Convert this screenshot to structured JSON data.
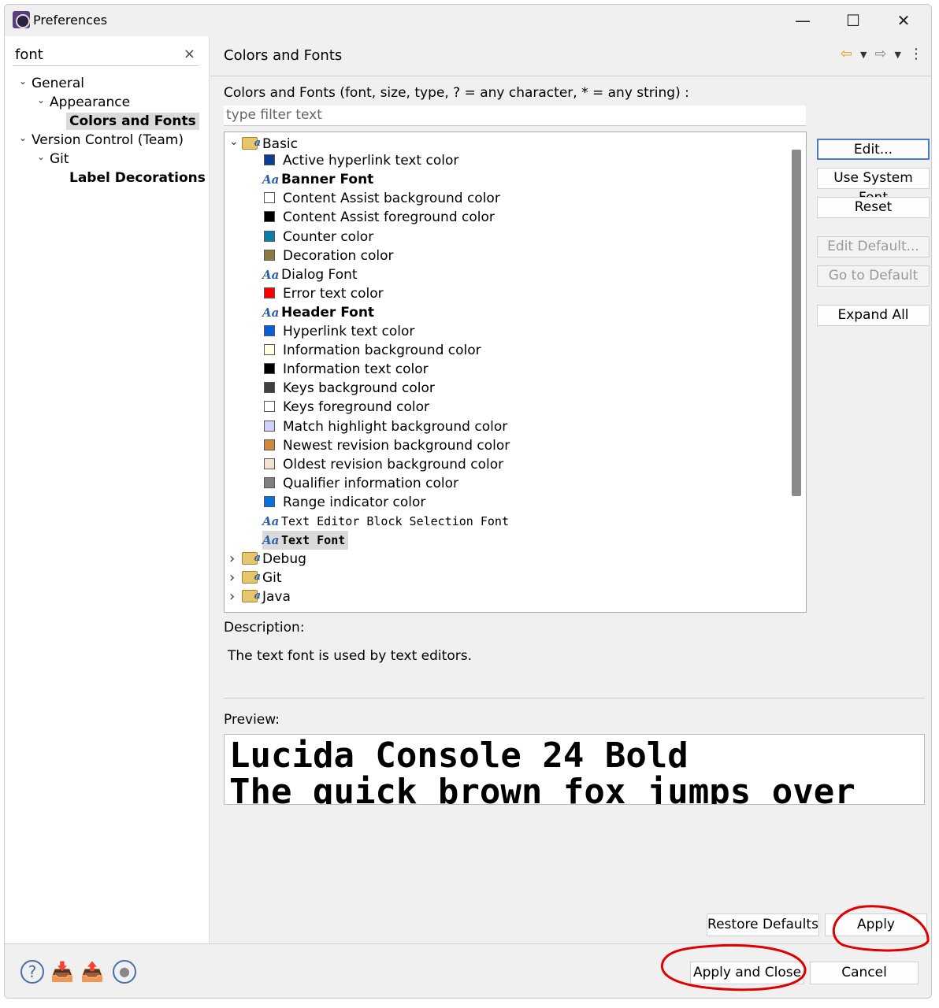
{
  "window": {
    "title": "Preferences",
    "minimize": "—",
    "maximize": "☐",
    "close": "✕"
  },
  "sidebar": {
    "search_value": "font",
    "clear": "×",
    "items": [
      {
        "label": "General",
        "level": 0,
        "expanded": true
      },
      {
        "label": "Appearance",
        "level": 1,
        "expanded": true
      },
      {
        "label": "Colors and Fonts",
        "level": 2,
        "selected": true,
        "bold": true
      },
      {
        "label": "Version Control (Team)",
        "level": 0,
        "expanded": true
      },
      {
        "label": "Git",
        "level": 1,
        "expanded": true
      },
      {
        "label": "Label Decorations",
        "level": 2,
        "bold": true
      }
    ]
  },
  "page": {
    "title": "Colors and Fonts",
    "filter_label": "Colors and Fonts (font, size, type, ? = any character, * = any string) :",
    "filter_placeholder": "type filter text",
    "tree": [
      {
        "type": "category",
        "label": "Basic",
        "expanded": true
      },
      {
        "type": "color",
        "label": "Active hyperlink text color",
        "color": "#0b3d91"
      },
      {
        "type": "font",
        "label": "Banner Font",
        "style": "bold"
      },
      {
        "type": "color",
        "label": "Content Assist background color",
        "color": "#ffffff"
      },
      {
        "type": "color",
        "label": "Content Assist foreground color",
        "color": "#000000"
      },
      {
        "type": "color",
        "label": "Counter color",
        "color": "#0a7fa8"
      },
      {
        "type": "color",
        "label": "Decoration color",
        "color": "#8c7a45"
      },
      {
        "type": "font",
        "label": "Dialog Font",
        "style": "normal"
      },
      {
        "type": "color",
        "label": "Error text color",
        "color": "#ff0000"
      },
      {
        "type": "font",
        "label": "Header Font",
        "style": "bold"
      },
      {
        "type": "color",
        "label": "Hyperlink text color",
        "color": "#0a5fd4"
      },
      {
        "type": "color",
        "label": "Information background color",
        "color": "#ffffe1"
      },
      {
        "type": "color",
        "label": "Information text color",
        "color": "#000000"
      },
      {
        "type": "color",
        "label": "Keys background color",
        "color": "#404040"
      },
      {
        "type": "color",
        "label": "Keys foreground color",
        "color": "#ffffff"
      },
      {
        "type": "color",
        "label": "Match highlight background color",
        "color": "#d0d0f8"
      },
      {
        "type": "color",
        "label": "Newest revision background color",
        "color": "#d08a3a"
      },
      {
        "type": "color",
        "label": "Oldest revision background color",
        "color": "#f2e2d2"
      },
      {
        "type": "color",
        "label": "Qualifier information color",
        "color": "#808080"
      },
      {
        "type": "color",
        "label": "Range indicator color",
        "color": "#0a70e0"
      },
      {
        "type": "font",
        "label": "Text Editor Block Selection Font",
        "style": "mono"
      },
      {
        "type": "font",
        "label": "Text Font",
        "style": "monobold",
        "selected": true
      },
      {
        "type": "category",
        "label": "Debug",
        "expanded": false
      },
      {
        "type": "category",
        "label": "Git",
        "expanded": false
      },
      {
        "type": "category",
        "label": "Java",
        "expanded": false
      }
    ],
    "buttons": [
      {
        "label": "Edit...",
        "enabled": true,
        "default": true
      },
      {
        "label": "Use System Font",
        "enabled": true
      },
      {
        "label": "Reset",
        "enabled": true
      },
      {
        "label": "Edit Default...",
        "enabled": false
      },
      {
        "label": "Go to Default",
        "enabled": false
      },
      {
        "label": "Expand All",
        "enabled": true
      }
    ],
    "description_label": "Description:",
    "description": "The text font is used by text editors.",
    "preview_label": "Preview:",
    "preview_lines": [
      "Lucida Console 24 Bold",
      "The quick brown fox jumps over"
    ],
    "restore_defaults": "Restore Defaults",
    "apply": "Apply"
  },
  "footer": {
    "apply_and_close": "Apply and Close",
    "cancel": "Cancel",
    "icons": [
      "help-icon",
      "import-icon",
      "export-icon",
      "record-icon"
    ]
  },
  "annotation_color": "#e00000"
}
